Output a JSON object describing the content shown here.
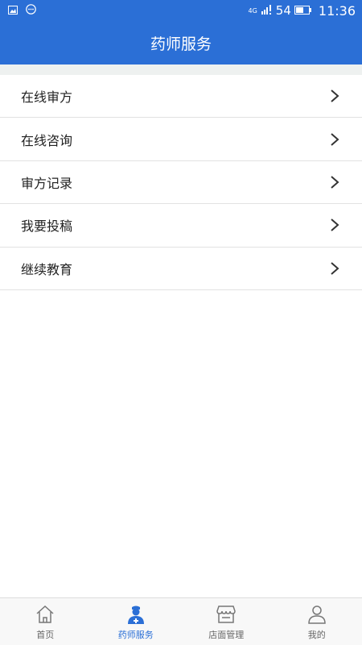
{
  "status_bar": {
    "network": "4G",
    "signal_text": "54",
    "time": "11:36"
  },
  "header": {
    "title": "药师服务"
  },
  "menu": {
    "items": [
      {
        "label": "在线审方"
      },
      {
        "label": "在线咨询"
      },
      {
        "label": "审方记录"
      },
      {
        "label": "我要投稿"
      },
      {
        "label": "继续教育"
      }
    ]
  },
  "tabbar": {
    "tabs": [
      {
        "label": "首页",
        "icon": "home-icon"
      },
      {
        "label": "药师服务",
        "icon": "pharmacist-icon",
        "active": true
      },
      {
        "label": "店面管理",
        "icon": "store-icon"
      },
      {
        "label": "我的",
        "icon": "person-icon"
      }
    ]
  },
  "colors": {
    "primary": "#2b6fd6",
    "band": "#eef1f0",
    "tab_inactive": "#666666"
  }
}
